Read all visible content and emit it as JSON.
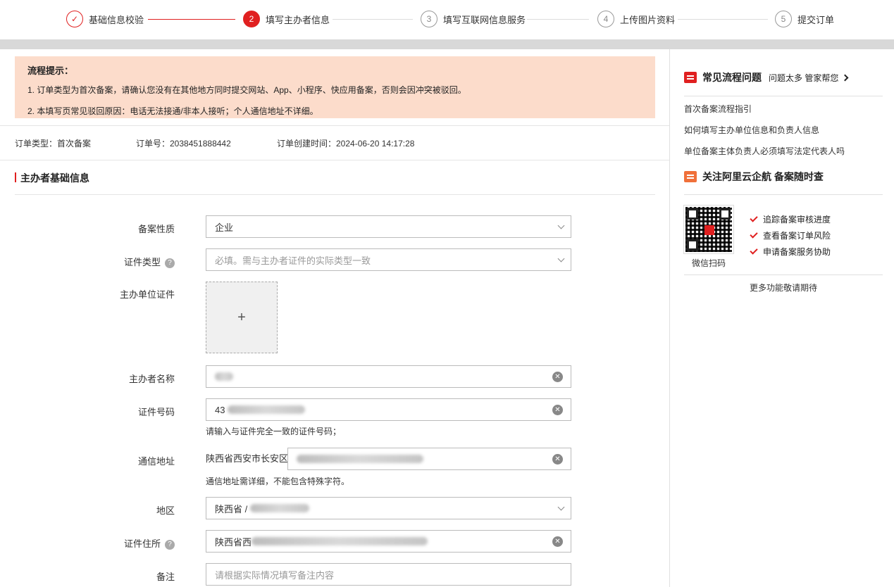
{
  "steps": [
    {
      "label": "基础信息校验",
      "num": "✓",
      "state": "done"
    },
    {
      "label": "填写主办者信息",
      "num": "2",
      "state": "active"
    },
    {
      "label": "填写互联网信息服务",
      "num": "3",
      "state": "todo"
    },
    {
      "label": "上传图片资料",
      "num": "4",
      "state": "todo"
    },
    {
      "label": "提交订单",
      "num": "5",
      "state": "todo"
    }
  ],
  "notice": {
    "title": "流程提示：",
    "line1": "1. 订单类型为首次备案，请确认您没有在其他地方同时提交网站、App、小程序、快应用备案，否则会因冲突被驳回。",
    "line2": "2. 本填写页常见驳回原因：电话无法接通/非本人接听；个人通信地址不详细。"
  },
  "order": {
    "type": "订单类型：首次备案",
    "number": "订单号：2038451888442",
    "created": "订单创建时间：2024-06-20 14:17:28"
  },
  "section_title": "主办者基础信息",
  "form": {
    "nature_label": "备案性质",
    "nature_value": "企业",
    "cert_type_label": "证件类型",
    "cert_type_placeholder": "必填。需与主办者证件的实际类型一致",
    "cert_upload_label": "主办单位证件",
    "upload_plus": "+",
    "sponsor_name_label": "主办者名称",
    "cert_no_label": "证件号码",
    "cert_no_prefix": "43",
    "cert_no_hint": "请输入与证件完全一致的证件号码；",
    "address_label": "通信地址",
    "address_prefix": "陕西省西安市长安区",
    "address_hint": "通信地址需详细，不能包含特殊字符。",
    "region_label": "地区",
    "region_prefix": "陕西省 /",
    "cert_address_label": "证件住所",
    "cert_address_prefix": "陕西省西",
    "remark_label": "备注",
    "remark_placeholder": "请根据实际情况填写备注内容",
    "help_glyph": "?",
    "clear_glyph": "✕"
  },
  "sidebar": {
    "faq_title": "常见流程问题",
    "faq_sub": "问题太多 管家帮您",
    "links": [
      "首次备案流程指引",
      "如何填写主办单位信息和负责人信息",
      "单位备案主体负责人必须填写法定代表人吗"
    ],
    "follow_title": "关注阿里云企航 备案随时查",
    "qr_caption": "微信扫码",
    "features": [
      "追踪备案审核进度",
      "查看备案订单风险",
      "申请备案服务协助"
    ],
    "more": "更多功能敬请期待"
  },
  "colors": {
    "accent": "#e02020",
    "notice_bg": "#fcdccb"
  }
}
